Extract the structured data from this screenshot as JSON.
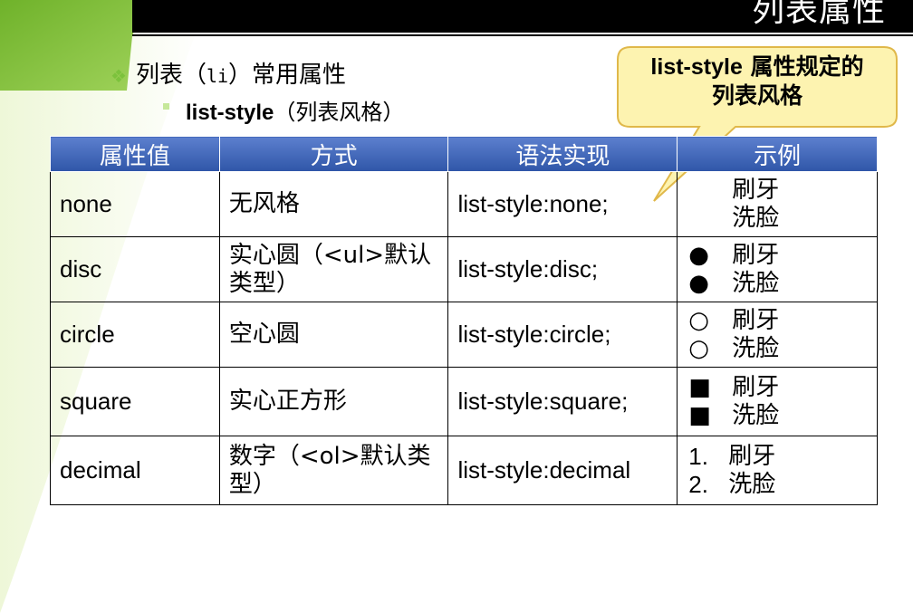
{
  "slide": {
    "title": "列表属性"
  },
  "bullets": {
    "level1_prefix": "列表（",
    "level1_code": "li",
    "level1_suffix": "）常用属性",
    "level2_bold": "list-style",
    "level2_rest": "（列表风格）"
  },
  "callout": {
    "line1_en": "list-style",
    "line1_cn": " 属性规定的",
    "line2": "列表风格"
  },
  "table": {
    "headers": [
      "属性值",
      "方式",
      "语法实现",
      "示例"
    ],
    "rows": [
      {
        "value": "none",
        "method": "无风格",
        "syntax": "list-style:none;",
        "marker": "",
        "items": [
          "刷牙",
          "洗脸"
        ]
      },
      {
        "value": "disc",
        "method": "实心圆（<ul>默认类型）",
        "syntax": "list-style:disc;",
        "marker": "●",
        "items": [
          "刷牙",
          "洗脸"
        ]
      },
      {
        "value": "circle",
        "method": "空心圆",
        "syntax": "list-style:circle;",
        "marker": "○",
        "items": [
          "刷牙",
          "洗脸"
        ]
      },
      {
        "value": "square",
        "method": "实心正方形",
        "syntax": "list-style:square;",
        "marker": "■",
        "items": [
          "刷牙",
          "洗脸"
        ]
      },
      {
        "value": "decimal",
        "method": "数字（<ol>默认类型）",
        "syntax": "list-style:decimal",
        "markers": [
          "1.",
          "2."
        ],
        "items": [
          "刷牙",
          "洗脸"
        ]
      }
    ]
  },
  "colors": {
    "header_blue": "#2f56a8",
    "title_bar": "#000000",
    "accent_green": "#7cc23c",
    "callout_fill": "#fdf3b0",
    "callout_border": "#e0b84a"
  }
}
